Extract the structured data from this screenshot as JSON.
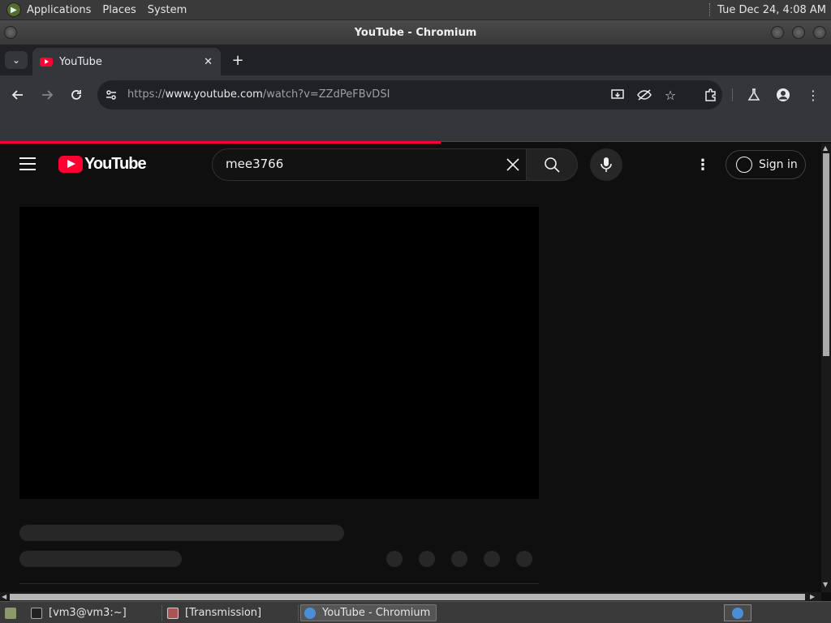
{
  "top_panel": {
    "menus": [
      "Applications",
      "Places",
      "System"
    ],
    "clock": "Tue Dec 24,  4:08 AM"
  },
  "window": {
    "title": "YouTube - Chromium"
  },
  "tabs": [
    {
      "label": "YouTube",
      "active": true
    }
  ],
  "toolbar": {
    "url_prefix": "https://",
    "url_domain": "www.youtube.com",
    "url_path": "/watch?v=ZZdPeFBvDSI"
  },
  "youtube": {
    "logo_text": "YouTube",
    "search_value": "mee3766",
    "sign_in_label": "Sign in",
    "brand_color": "#ff0033"
  },
  "taskbar": {
    "items": [
      {
        "label": "[vm3@vm3:~]",
        "active": false
      },
      {
        "label": "[Transmission]",
        "active": false
      },
      {
        "label": "YouTube - Chromium",
        "active": true
      }
    ]
  },
  "page_load_progress": 0.53
}
